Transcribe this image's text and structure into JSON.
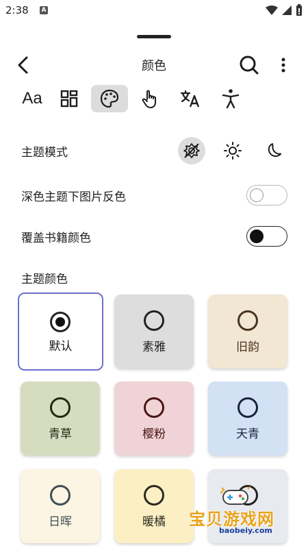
{
  "status_bar": {
    "time": "2:38",
    "notification_glyph": "A"
  },
  "toolbar": {
    "title": "颜色",
    "back_icon": "chevron-left-icon",
    "search_icon": "search-icon",
    "more_icon": "more-vertical-icon"
  },
  "tabs": [
    {
      "name": "text",
      "icon": "font-icon",
      "label": "Aa",
      "active": false
    },
    {
      "name": "layout",
      "icon": "layout-grid-icon",
      "active": false
    },
    {
      "name": "color",
      "icon": "palette-icon",
      "active": true
    },
    {
      "name": "gesture",
      "icon": "touch-hand-icon",
      "active": false
    },
    {
      "name": "translate",
      "icon": "translate-icon",
      "active": false
    },
    {
      "name": "accessibility",
      "icon": "accessibility-icon",
      "active": false
    }
  ],
  "settings": {
    "theme_mode_label": "主题模式",
    "theme_modes": [
      {
        "name": "auto",
        "icon": "auto-brightness-icon",
        "active": true
      },
      {
        "name": "light",
        "icon": "sun-icon",
        "active": false
      },
      {
        "name": "dark",
        "icon": "moon-icon",
        "active": false
      }
    ],
    "invert_images_label": "深色主题下图片反色",
    "invert_images_on": false,
    "override_book_colors_label": "覆盖书籍颜色",
    "override_book_colors_on": true,
    "theme_color_label": "主题颜色"
  },
  "swatches": [
    {
      "label": "默认",
      "bg": "#ffffff",
      "fg": "#1c1c1c",
      "selected": true
    },
    {
      "label": "素雅",
      "bg": "#dddddd",
      "fg": "#222222",
      "selected": false
    },
    {
      "label": "旧韵",
      "bg": "#f1e7d3",
      "fg": "#4a3320",
      "selected": false
    },
    {
      "label": "青草",
      "bg": "#d6dcc0",
      "fg": "#1f2a14",
      "selected": false
    },
    {
      "label": "樱粉",
      "bg": "#f0d3d6",
      "fg": "#4a1414",
      "selected": false
    },
    {
      "label": "天青",
      "bg": "#d3e1f5",
      "fg": "#17243d",
      "selected": false
    },
    {
      "label": "日晖",
      "bg": "#fdf5e3",
      "fg": "#3f4e55",
      "selected": false
    },
    {
      "label": "暖橘",
      "bg": "#fbefc3",
      "fg": "#2a2a1f",
      "selected": false
    },
    {
      "label": "",
      "bg": "#e7eaee",
      "fg": "#222222",
      "selected": false
    }
  ],
  "watermark": {
    "text": "宝贝游戏网",
    "url": "baobeiy.com"
  },
  "colors": {
    "accent": "#6b6fcf",
    "toggle_on": "#111111",
    "active_bg": "#dcdcdc"
  }
}
